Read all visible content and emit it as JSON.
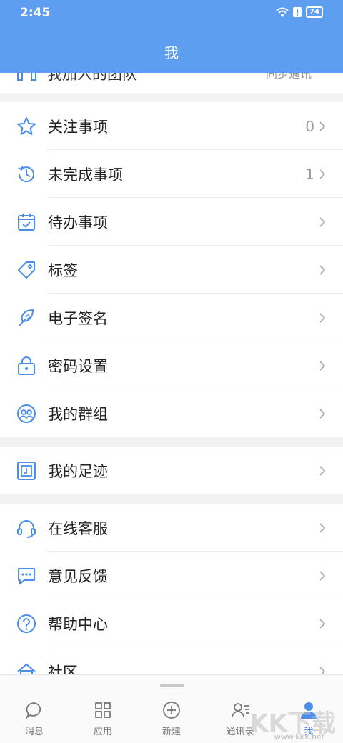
{
  "status": {
    "time": "2:45",
    "battery": "74"
  },
  "header": {
    "title": "我"
  },
  "partial_row": {
    "text": "我加入的团队",
    "right": "同步通讯"
  },
  "groups": [
    [
      {
        "id": "follow",
        "label": "关注事项",
        "count": "0",
        "icon": "star-icon"
      },
      {
        "id": "unfinished",
        "label": "未完成事项",
        "count": "1",
        "icon": "history-icon"
      },
      {
        "id": "todo",
        "label": "待办事项",
        "count": "",
        "icon": "calendar-check-icon"
      },
      {
        "id": "tags",
        "label": "标签",
        "count": "",
        "icon": "tag-icon"
      },
      {
        "id": "esign",
        "label": "电子签名",
        "count": "",
        "icon": "signature-feather-icon"
      },
      {
        "id": "password",
        "label": "密码设置",
        "count": "",
        "icon": "lock-icon"
      },
      {
        "id": "groups",
        "label": "我的群组",
        "count": "",
        "icon": "group-icon"
      }
    ],
    [
      {
        "id": "footprint",
        "label": "我的足迹",
        "count": "",
        "icon": "footprint-icon"
      }
    ],
    [
      {
        "id": "service",
        "label": "在线客服",
        "count": "",
        "icon": "headset-icon"
      },
      {
        "id": "feedback",
        "label": "意见反馈",
        "count": "",
        "icon": "chat-dots-icon"
      },
      {
        "id": "help",
        "label": "帮助中心",
        "count": "",
        "icon": "help-circle-icon"
      },
      {
        "id": "community",
        "label": "社区",
        "count": "",
        "icon": "community-house-icon"
      }
    ]
  ],
  "tabs": [
    {
      "id": "messages",
      "label": "消息",
      "icon": "chat-bubble-icon",
      "active": false
    },
    {
      "id": "apps",
      "label": "应用",
      "icon": "grid-icon",
      "active": false
    },
    {
      "id": "new",
      "label": "新建",
      "icon": "plus-circle-icon",
      "active": false
    },
    {
      "id": "contacts",
      "label": "通讯录",
      "icon": "contacts-icon",
      "active": false
    },
    {
      "id": "me",
      "label": "我",
      "icon": "person-icon",
      "active": true
    }
  ],
  "watermark": {
    "text": "KK下载",
    "url": "www.kkx.net"
  },
  "colors": {
    "accent": "#5d9ef0",
    "icon": "#4a8eea"
  }
}
